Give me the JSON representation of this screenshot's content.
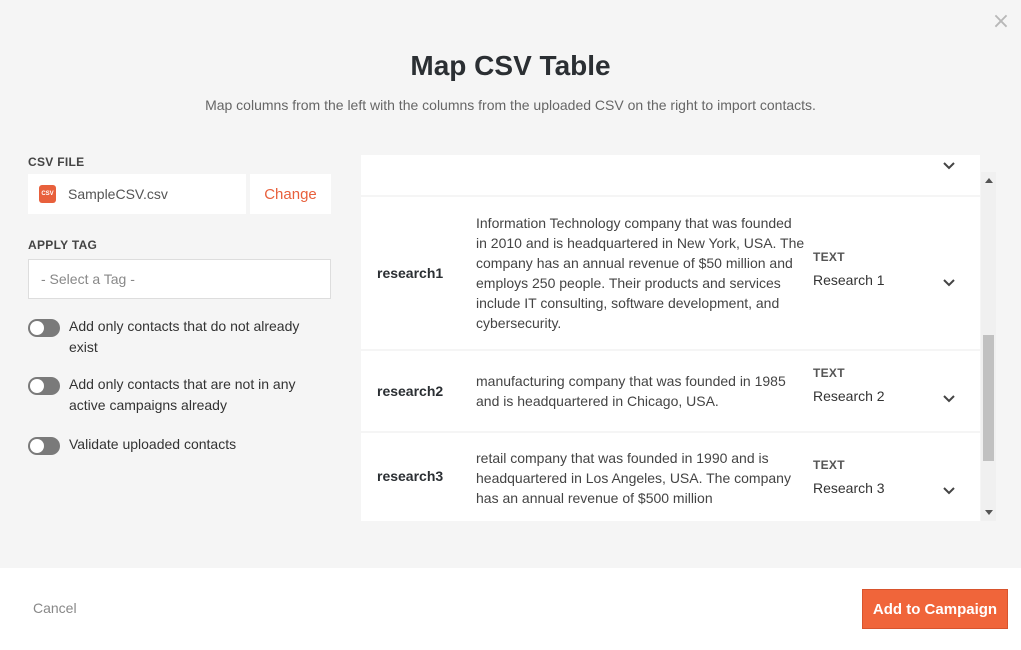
{
  "modal": {
    "title": "Map CSV Table",
    "subtitle": "Map columns from the left with the columns from the uploaded CSV on the right to import contacts.",
    "close_icon": "close-icon"
  },
  "left": {
    "csv_file_label": "CSV FILE",
    "file_name": "SampleCSV.csv",
    "file_icon_text": "CSV",
    "change_label": "Change",
    "apply_tag_label": "APPLY TAG",
    "tag_placeholder": "- Select a Tag -",
    "toggles": [
      {
        "label": "Add only contacts that do not already exist",
        "on": false
      },
      {
        "label": "Add only contacts that are not in any active campaigns already",
        "on": false
      },
      {
        "label": "Validate uploaded contacts",
        "on": false
      }
    ]
  },
  "mapping": {
    "rows": [
      {
        "key": "research1",
        "desc": "Information Technology company that was founded in 2010 and is headquartered in New York, USA. The company has an annual revenue of $50 million and employs 250 people. Their products and services include IT consulting, software development, and cybersecurity.",
        "type_label": "TEXT",
        "type_value": "Research 1"
      },
      {
        "key": "research2",
        "desc": "manufacturing company that was founded in 1985 and is headquartered in Chicago, USA.",
        "type_label": "TEXT",
        "type_value": "Research 2"
      },
      {
        "key": "research3",
        "desc": "retail company that was founded in 1990 and is headquartered in Los Angeles, USA. The company has an annual revenue of $500 million",
        "type_label": "TEXT",
        "type_value": "Research 3"
      }
    ]
  },
  "footer": {
    "cancel_label": "Cancel",
    "add_label": "Add to Campaign"
  },
  "colors": {
    "accent": "#f0653a",
    "background": "#f5f5f5"
  }
}
